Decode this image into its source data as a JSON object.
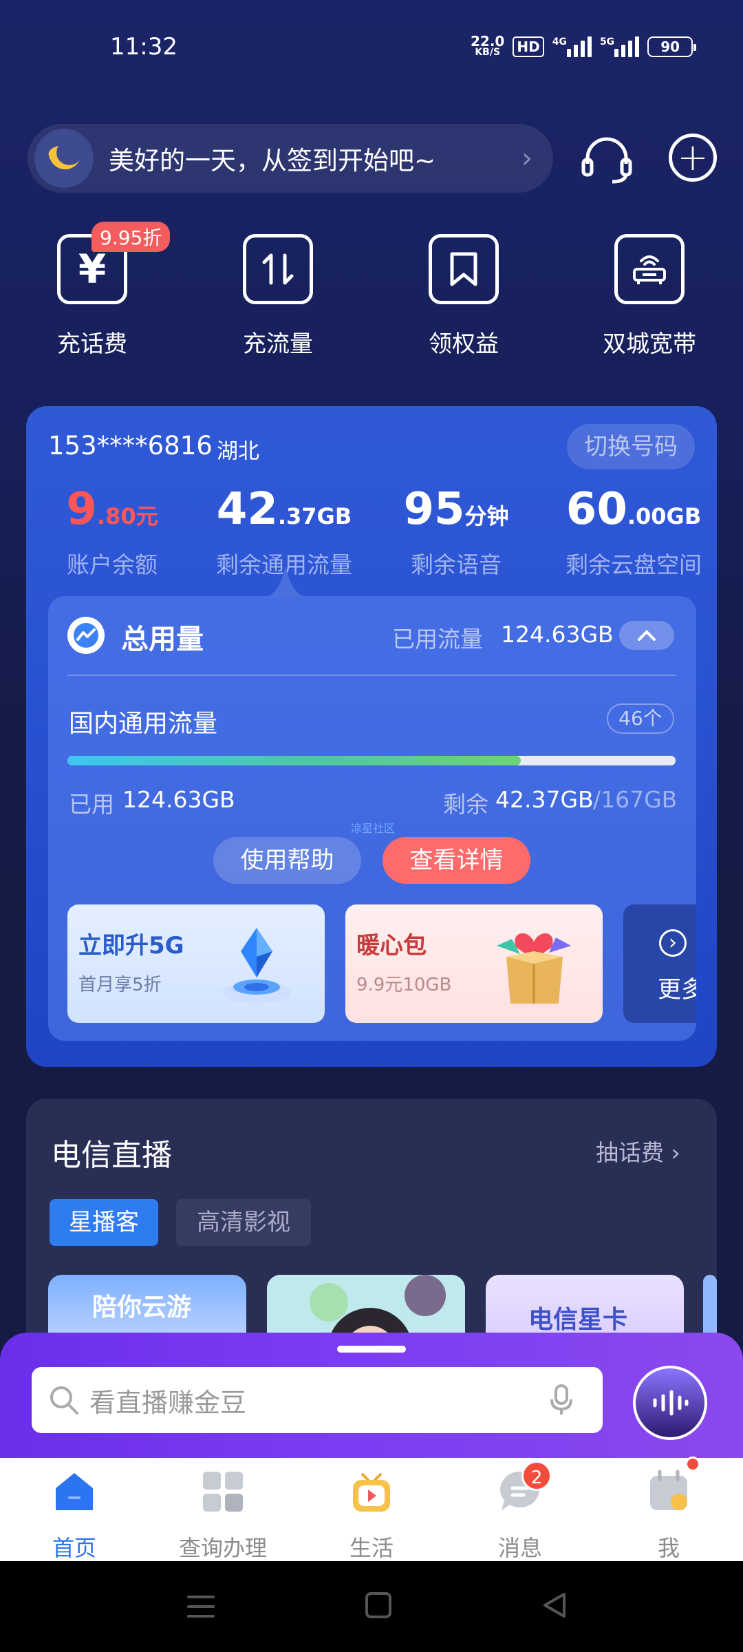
{
  "status_bar": {
    "time": "11:32",
    "net_speed_value": "22.0",
    "net_speed_unit": "KB/S",
    "hd": "HD",
    "net_4g": "4G",
    "net_5g": "5G",
    "battery": "90"
  },
  "header": {
    "checkin_text": "美好的一天，从签到开始吧~"
  },
  "quick_actions": [
    {
      "label": "充话费",
      "icon": "yuan-icon",
      "badge": "9.95折"
    },
    {
      "label": "充流量",
      "icon": "data-transfer-icon"
    },
    {
      "label": "领权益",
      "icon": "bookmark-icon"
    },
    {
      "label": "双城宽带",
      "icon": "router-icon"
    }
  ],
  "account": {
    "phone": "153****6816",
    "region": "湖北",
    "switch_label": "切换号码",
    "stats": [
      {
        "value": "9",
        "decimal": ".80",
        "unit": "元",
        "label": "账户余额"
      },
      {
        "value": "42",
        "decimal": ".37",
        "unit": "GB",
        "label": "剩余通用流量"
      },
      {
        "value": "95",
        "decimal": "",
        "unit": "分钟",
        "label": "剩余语音"
      },
      {
        "value": "60",
        "decimal": ".00",
        "unit": "GB",
        "label": "剩余云盘空间"
      }
    ]
  },
  "usage": {
    "title": "总用量",
    "used_label": "已用流量",
    "used_value": "124.63GB",
    "domestic_label": "国内通用流量",
    "count_badge": "46个",
    "used_short_label": "已用",
    "used_short_value": "124.63GB",
    "remaining_label": "剩余",
    "remaining_value": "42.37GB",
    "total_value": "/167GB",
    "progress_fraction": 0.746,
    "watermark": "凉星社区",
    "help_label": "使用帮助",
    "detail_label": "查看详情"
  },
  "promos": [
    {
      "title": "立即升5G",
      "subtitle": "首月享5折"
    },
    {
      "title": "暖心包",
      "subtitle": "9.9元10GB"
    }
  ],
  "more_label": "更多",
  "live": {
    "title": "电信直播",
    "more_label": "抽话费",
    "tabs": [
      "星播客",
      "高清影视"
    ],
    "thumbs": [
      "陪你云游",
      "",
      "电信星卡"
    ]
  },
  "search": {
    "placeholder": "看直播赚金豆"
  },
  "nav": [
    {
      "label": "首页",
      "active": true
    },
    {
      "label": "查询办理"
    },
    {
      "label": "生活"
    },
    {
      "label": "消息",
      "badge": "2"
    },
    {
      "label": "我"
    }
  ],
  "colors": {
    "accent_blue": "#2c74f0",
    "balance_red": "#ff5757",
    "detail_button": "#ff6b6b",
    "promo_purple": "#7b3df2"
  }
}
